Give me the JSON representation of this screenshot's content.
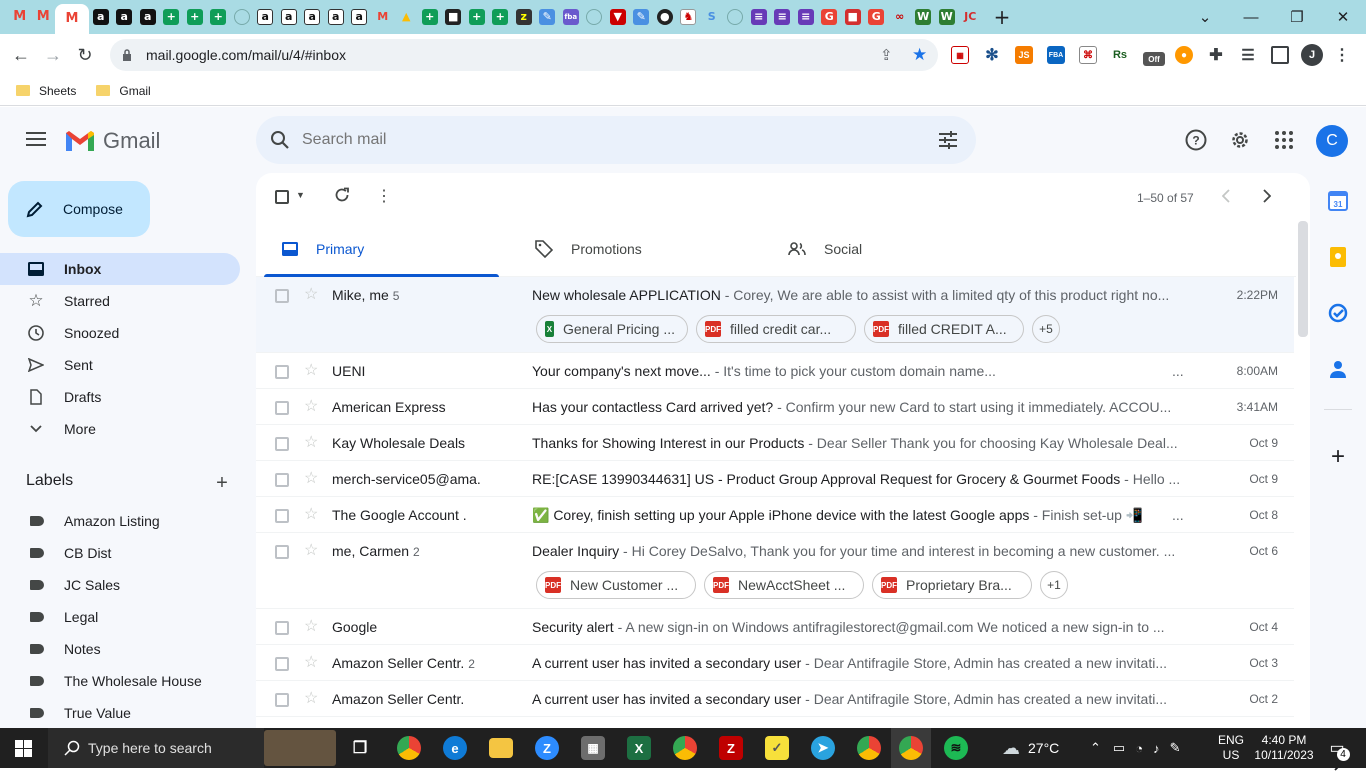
{
  "browser": {
    "url": "mail.google.com/mail/u/4/#inbox",
    "bookmarks": [
      "Sheets",
      "Gmail"
    ],
    "profile_initial": "J",
    "ext_off_badge": "Off",
    "ext_js": "JS",
    "ext_fba": "FBA",
    "ext_rs": "Rs"
  },
  "gmail": {
    "logo_text": "Gmail",
    "search_placeholder": "Search mail",
    "avatar_initial": "C",
    "compose_label": "Compose",
    "nav": [
      {
        "label": "Inbox"
      },
      {
        "label": "Starred"
      },
      {
        "label": "Snoozed"
      },
      {
        "label": "Sent"
      },
      {
        "label": "Drafts"
      },
      {
        "label": "More"
      }
    ],
    "labels_heading": "Labels",
    "labels": [
      "Amazon Listing",
      "CB Dist",
      "JC Sales",
      "Legal",
      "Notes",
      "The Wholesale House",
      "True Value"
    ],
    "pagination": "1–50 of 57",
    "tabs": [
      "Primary",
      "Promotions",
      "Social"
    ],
    "calendar_day": "31"
  },
  "emails": [
    {
      "sender": "Mike, me",
      "count": "5",
      "subject": "New wholesale APPLICATION",
      "snippet": " - Corey, We are able to assist with a limited qty of this product right no...",
      "date": "2:22PM",
      "attachments": [
        {
          "name": "General Pricing ...",
          "type": "sheet",
          "icon": "X"
        },
        {
          "name": "filled credit car...",
          "type": "pdf",
          "icon": "PDF"
        },
        {
          "name": "filled CREDIT A...",
          "type": "pdf",
          "icon": "PDF"
        }
      ],
      "more": "+5"
    },
    {
      "sender": "UENI",
      "count": "",
      "subject": "Your company's next move...",
      "snippet": " - It's time to pick your custom domain name...",
      "date": "8:00AM",
      "trail": "..."
    },
    {
      "sender": "American Express",
      "count": "",
      "subject": "Has your contactless Card arrived yet?",
      "snippet": " - Confirm your new Card to start using it immediately. ACCOU...",
      "date": "3:41AM"
    },
    {
      "sender": "Kay Wholesale Deals",
      "count": "",
      "subject": "Thanks for Showing Interest in our Products",
      "snippet": " - Dear Seller Thank you for choosing Kay Wholesale Deal...",
      "date": "Oct 9"
    },
    {
      "sender": "merch-service05@ama.",
      "count": "",
      "subject": "RE:[CASE 13990344631] US - Product Group Approval Request for Grocery & Gourmet Foods",
      "snippet": " - Hello ...",
      "date": "Oct 9"
    },
    {
      "sender": "The Google Account .",
      "count": "",
      "subject": "✅ Corey, finish setting up your Apple iPhone device with the latest Google apps",
      "snippet": " - Finish set-up 📲",
      "date": "Oct 8",
      "trail": "..."
    },
    {
      "sender": "me, Carmen",
      "count": "2",
      "subject": "Dealer Inquiry",
      "snippet": " - Hi Corey DeSalvo, Thank you for your time and interest in becoming a new customer. ...",
      "date": "Oct 6",
      "attachments": [
        {
          "name": "New Customer ...",
          "type": "pdf",
          "icon": "PDF"
        },
        {
          "name": "NewAcctSheet ...",
          "type": "pdf",
          "icon": "PDF"
        },
        {
          "name": "Proprietary Bra...",
          "type": "pdf",
          "icon": "PDF"
        }
      ],
      "more": "+1"
    },
    {
      "sender": "Google",
      "count": "",
      "subject": "Security alert",
      "snippet": " - A new sign-in on Windows antifragilestorect@gmail.com We noticed a new sign-in to ...",
      "date": "Oct 4"
    },
    {
      "sender": "Amazon Seller Centr.",
      "count": "2",
      "subject": "A current user has invited a secondary user",
      "snippet": " - Dear Antifragile Store, Admin has created a new invitati...",
      "date": "Oct 3"
    },
    {
      "sender": "Amazon Seller Centr.",
      "count": "",
      "subject": "A current user has invited a secondary user",
      "snippet": " - Dear Antifragile Store, Admin has created a new invitati...",
      "date": "Oct 2"
    }
  ],
  "taskbar": {
    "search_placeholder": "Type here to search",
    "weather": "27°C",
    "lang": "ENG",
    "region": "US",
    "time": "4:40 PM",
    "date": "10/11/2023",
    "notifications": "4"
  }
}
